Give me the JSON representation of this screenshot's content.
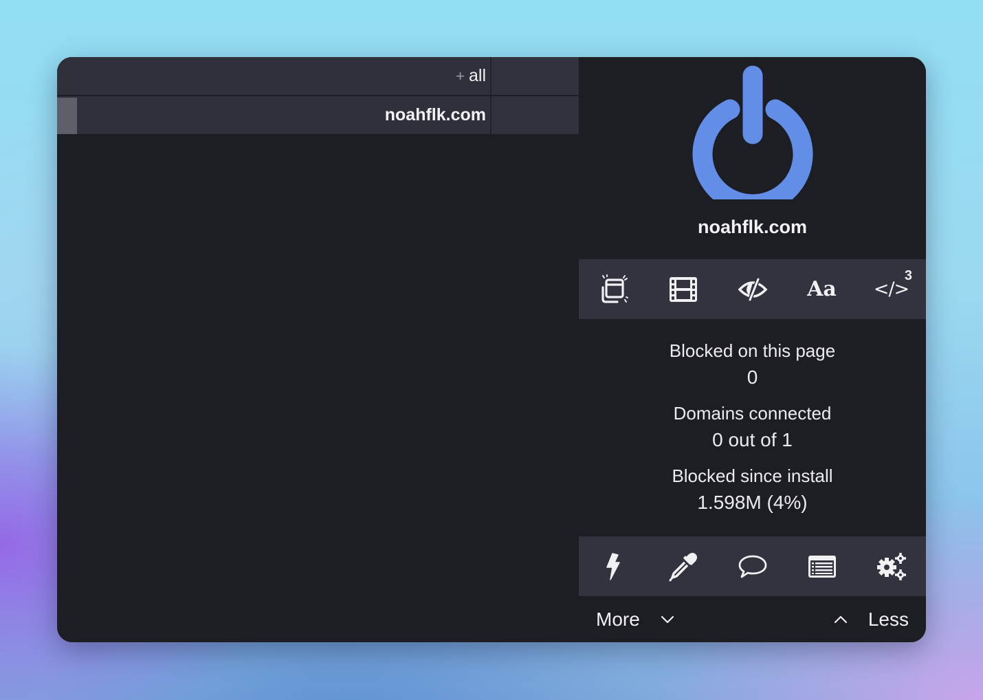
{
  "app": {
    "name": "uBlock Origin popup",
    "accent_color": "#628ee8"
  },
  "domain_list": {
    "all_row": {
      "prefix": "+",
      "label": "all"
    },
    "rows": [
      {
        "label": "noahflk.com"
      }
    ]
  },
  "main": {
    "power_icon": "power-icon",
    "hostname": "noahflk.com"
  },
  "top_toolbar": {
    "items": [
      {
        "icon": "popup-block-icon",
        "label": ""
      },
      {
        "icon": "media-film-icon",
        "label": ""
      },
      {
        "icon": "cosmetic-filter-eye-icon",
        "label": ""
      },
      {
        "icon": "remote-fonts-icon",
        "label": "Aa"
      },
      {
        "icon": "javascript-code-icon",
        "label": "</>",
        "badge": "3"
      }
    ]
  },
  "stats": {
    "blocked_page": {
      "label": "Blocked on this page",
      "value": "0"
    },
    "domains_connected": {
      "label": "Domains connected",
      "value": "0 out of 1"
    },
    "blocked_install": {
      "label": "Blocked since install",
      "value": "1.598M (4%)"
    }
  },
  "bottom_toolbar": {
    "items": [
      {
        "icon": "lightning-zapper-icon"
      },
      {
        "icon": "eyedropper-picker-icon"
      },
      {
        "icon": "speech-bubble-report-icon"
      },
      {
        "icon": "list-logger-icon"
      },
      {
        "icon": "gears-dashboard-icon"
      }
    ]
  },
  "footer": {
    "more_label": "More",
    "less_label": "Less"
  }
}
